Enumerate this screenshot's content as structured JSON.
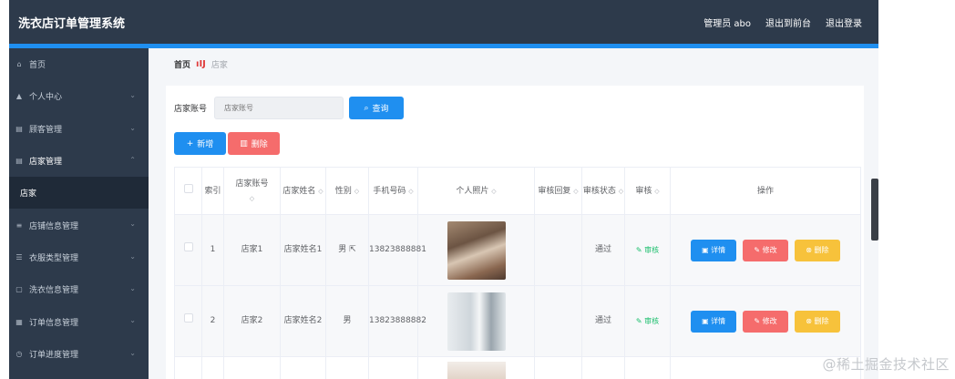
{
  "header": {
    "app_title": "洗衣店订单管理系统",
    "user_label": "管理员 abo",
    "back_to_front": "退出到前台",
    "logout": "退出登录"
  },
  "sidebar": {
    "items": [
      {
        "label": "首页",
        "icon": "home-icon"
      },
      {
        "label": "个人中心",
        "icon": "user-icon"
      },
      {
        "label": "顾客管理",
        "icon": "list-icon"
      },
      {
        "label": "店家管理",
        "icon": "list-icon"
      },
      {
        "label": "店家",
        "icon": ""
      },
      {
        "label": "店铺信息管理",
        "icon": "menu-icon"
      },
      {
        "label": "衣服类型管理",
        "icon": "sort-icon"
      },
      {
        "label": "洗衣信息管理",
        "icon": "doc-icon"
      },
      {
        "label": "订单信息管理",
        "icon": "file-icon"
      },
      {
        "label": "订单进度管理",
        "icon": "clock-icon"
      }
    ]
  },
  "breadcrumb": {
    "home": "首页",
    "current": "店家"
  },
  "search": {
    "label": "店家账号",
    "placeholder": "店家账号",
    "query_button": "查询"
  },
  "actions": {
    "add": "新增",
    "delete": "删除"
  },
  "table": {
    "headers": {
      "index": "索引",
      "account": "店家账号",
      "name": "店家姓名",
      "gender": "性别",
      "phone": "手机号码",
      "photo": "个人照片",
      "reply": "审核回复",
      "status": "审核状态",
      "audit": "审核",
      "ops": "操作"
    },
    "rows": [
      {
        "index": "1",
        "account": "店家1",
        "name": "店家姓名1",
        "gender": "男",
        "phone": "13823888881",
        "reply": "",
        "status": "通过",
        "audit": "审核"
      },
      {
        "index": "2",
        "account": "店家2",
        "name": "店家姓名2",
        "gender": "男",
        "phone": "13823888882",
        "reply": "",
        "status": "通过",
        "audit": "审核"
      }
    ],
    "op_labels": {
      "detail": "详情",
      "edit": "修改",
      "remove": "删除"
    }
  },
  "watermark": "@稀土掘金技术社区"
}
